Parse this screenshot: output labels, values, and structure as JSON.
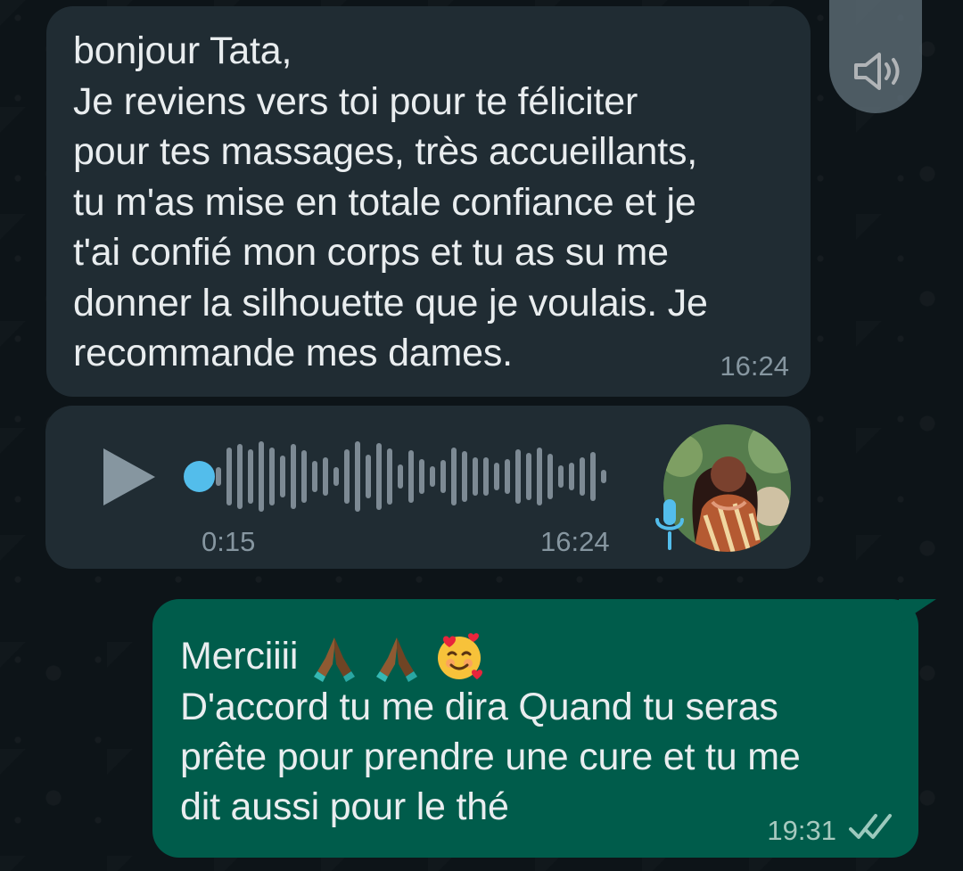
{
  "messages": [
    {
      "text": "bonjour Tata,\nJe reviens vers toi pour te féliciter\npour tes massages, très accueillants,\ntu m'as mise en totale confiance et je\nt'ai confié mon corps et tu as su me\ndonner la silhouette que je voulais. Je\nrecommande mes dames.",
      "time": "16:24"
    },
    {
      "voice_duration": "0:15",
      "time": "16:24"
    },
    {
      "first_line": "Merciiii",
      "body": "D'accord tu me dira Quand tu seras\nprête pour prendre une cure et tu me\ndit aussi pour le thé",
      "time": "19:31"
    }
  ],
  "icons": {
    "audio": "speaker-icon",
    "play": "play-icon",
    "mic": "mic-icon",
    "checks": "double-check-icon"
  },
  "colors": {
    "incoming_bubble": "#202c33",
    "outgoing_bubble": "#005c4b",
    "accent": "#53bdeb"
  }
}
